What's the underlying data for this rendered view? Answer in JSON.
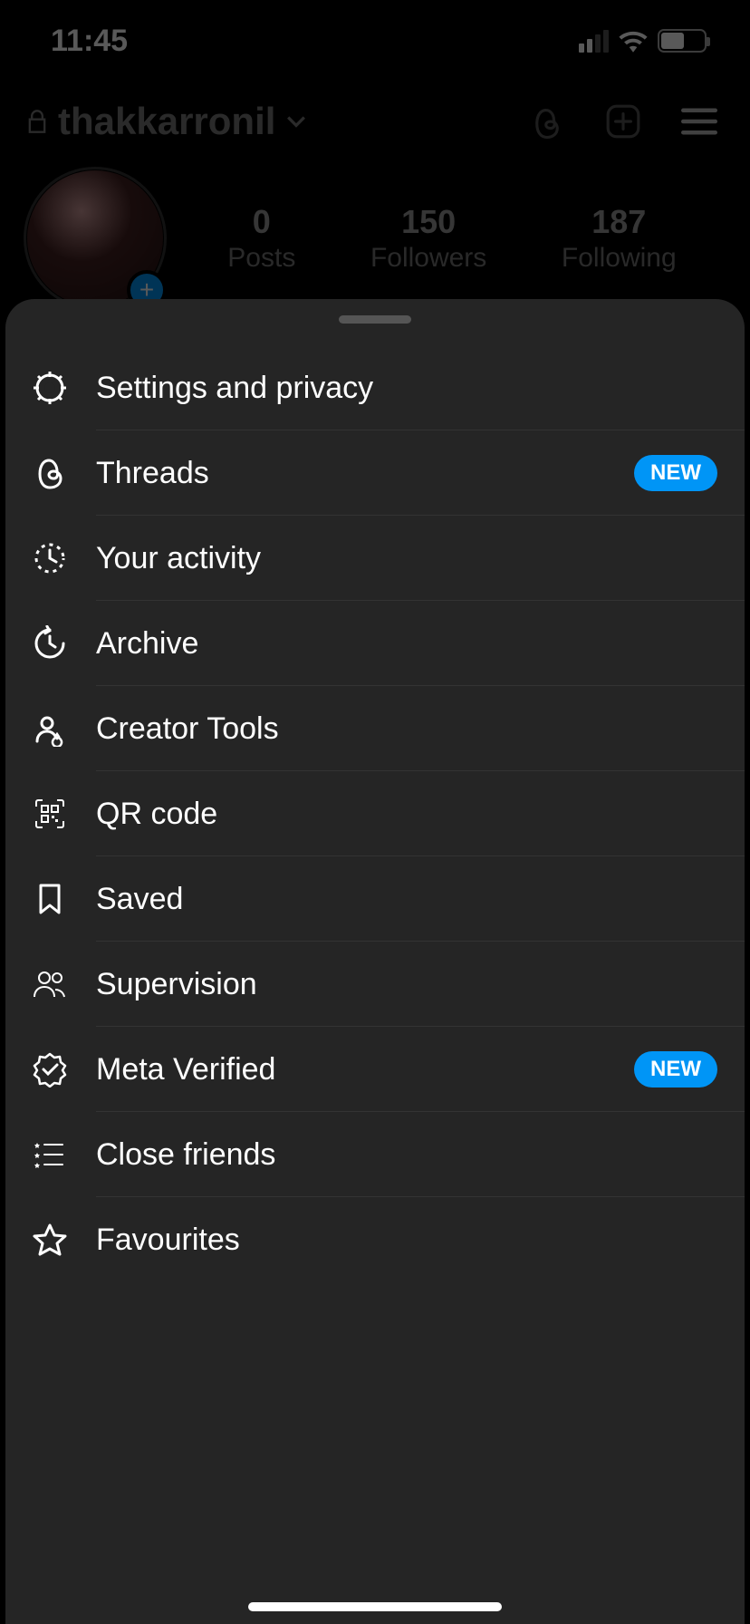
{
  "status": {
    "time": "11:45"
  },
  "profile": {
    "username": "thakkarronil",
    "stats": [
      {
        "num": "0",
        "label": "Posts"
      },
      {
        "num": "150",
        "label": "Followers"
      },
      {
        "num": "187",
        "label": "Following"
      }
    ]
  },
  "menu": {
    "items": [
      {
        "label": "Settings and privacy",
        "badge": null
      },
      {
        "label": "Threads",
        "badge": "NEW"
      },
      {
        "label": "Your activity",
        "badge": null
      },
      {
        "label": "Archive",
        "badge": null
      },
      {
        "label": "Creator Tools",
        "badge": null
      },
      {
        "label": "QR code",
        "badge": null
      },
      {
        "label": "Saved",
        "badge": null
      },
      {
        "label": "Supervision",
        "badge": null
      },
      {
        "label": "Meta Verified",
        "badge": "NEW"
      },
      {
        "label": "Close friends",
        "badge": null
      },
      {
        "label": "Favourites",
        "badge": null
      }
    ]
  }
}
